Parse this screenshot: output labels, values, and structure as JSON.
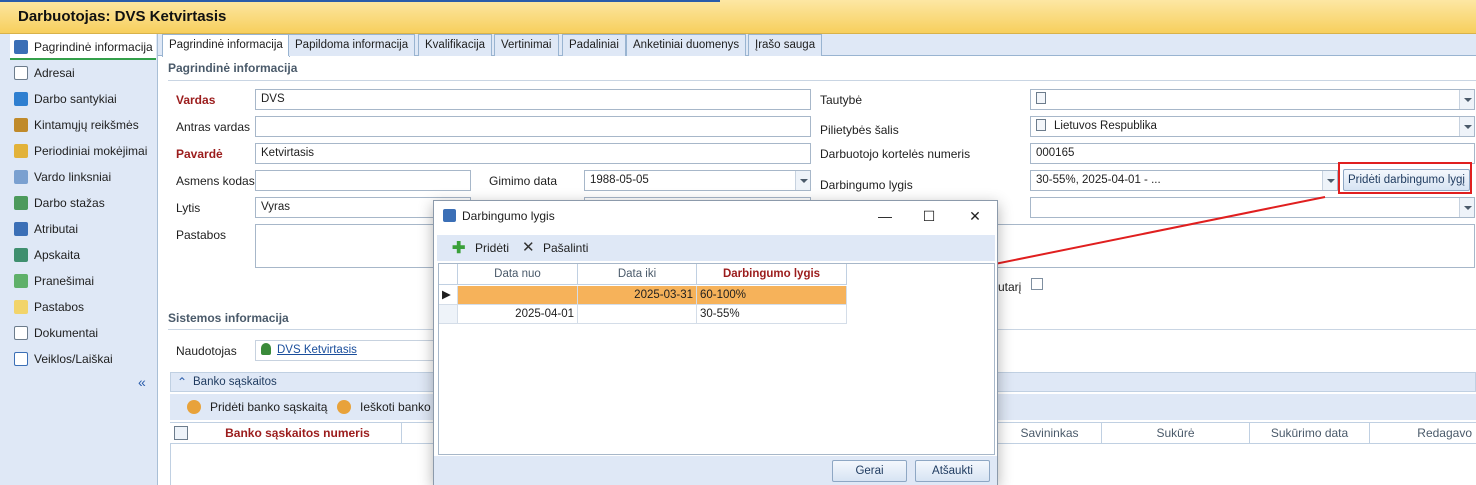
{
  "window": {
    "title": "Darbuotojas: DVS Ketvirtasis"
  },
  "nav": {
    "items": [
      {
        "label": "Pagrindinė informacija",
        "icon": "employee-card-icon"
      },
      {
        "label": "Adresai",
        "icon": "address-icon"
      },
      {
        "label": "Darbo santykiai",
        "icon": "contract-icon"
      },
      {
        "label": "Kintamųjų reikšmės",
        "icon": "book-icon"
      },
      {
        "label": "Periodiniai mokėjimai",
        "icon": "payments-icon"
      },
      {
        "label": "Vardo linksniai",
        "icon": "declension-icon"
      },
      {
        "label": "Darbo stažas",
        "icon": "seniority-icon"
      },
      {
        "label": "Atributai",
        "icon": "attributes-icon"
      },
      {
        "label": "Apskaita",
        "icon": "accounting-icon"
      },
      {
        "label": "Pranešimai",
        "icon": "messages-icon"
      },
      {
        "label": "Pastabos",
        "icon": "notes-icon"
      },
      {
        "label": "Dokumentai",
        "icon": "documents-icon"
      },
      {
        "label": "Veiklos/Laiškai",
        "icon": "activities-icon"
      }
    ],
    "collapse": "«"
  },
  "tabs": [
    "Pagrindinė informacija",
    "Papildoma informacija",
    "Kvalifikacija",
    "Vertinimai",
    "Padaliniai",
    "Anketiniai duomenys",
    "Įrašo sauga"
  ],
  "main": {
    "section_title": "Pagrindinė informacija",
    "vardas_label": "Vardas",
    "vardas_value": "DVS",
    "antras_vardas_label": "Antras vardas",
    "antras_vardas_value": "",
    "pavarde_label": "Pavardė",
    "pavarde_value": "Ketvirtasis",
    "asmens_kodas_label": "Asmens kodas",
    "asmens_kodas_value": "",
    "gimimo_data_label": "Gimimo data",
    "gimimo_data_value": "1988-05-05",
    "lytis_label": "Lytis",
    "lytis_value": "Vyras",
    "pastabos_label": "Pastabos",
    "tautybe_label": "Tautybė",
    "tautybe_value": "",
    "pilietybe_label": "Pilietybės šalis",
    "pilietybe_value": "Lietuvos Respublika",
    "kortele_label": "Darbuotojo kortelės numeris",
    "kortele_value": "000165",
    "darbingumas_label": "Darbingumo lygis",
    "darbingumas_value": "30-55%, 2025-04-01 - ...",
    "add_darbingumas_button": "Pridėti darbingumo lygį",
    "hidden_check_label_tail": "utarį"
  },
  "system": {
    "section_title": "Sistemos informacija",
    "naudotojas_label": "Naudotojas",
    "naudotojas_value": "DVS Ketvirtasis"
  },
  "bank": {
    "header": "Banko sąskaitos",
    "add_button": "Pridėti banko sąskaitą",
    "search_button": "Ieškoti banko",
    "columns": [
      "Banko sąskaitos numeris",
      "Savininkas",
      "Sukūrė",
      "Sukūrimo data",
      "Redagavo"
    ]
  },
  "dialog": {
    "title": "Darbingumo lygis",
    "add": "Pridėti",
    "remove": "Pašalinti",
    "columns": [
      "Data nuo",
      "Data iki",
      "Darbingumo lygis"
    ],
    "rows": [
      {
        "nuo": "",
        "iki": "2025-03-31",
        "lygis": "60-100%"
      },
      {
        "nuo": "2025-04-01",
        "iki": "",
        "lygis": "30-55%"
      }
    ],
    "ok": "Gerai",
    "cancel": "Atšaukti"
  },
  "colors": {
    "accent": "#2a5caa",
    "title_bar": "#f7cf5d",
    "selected_row": "#f6b25a",
    "highlight": "#e01f1f"
  }
}
